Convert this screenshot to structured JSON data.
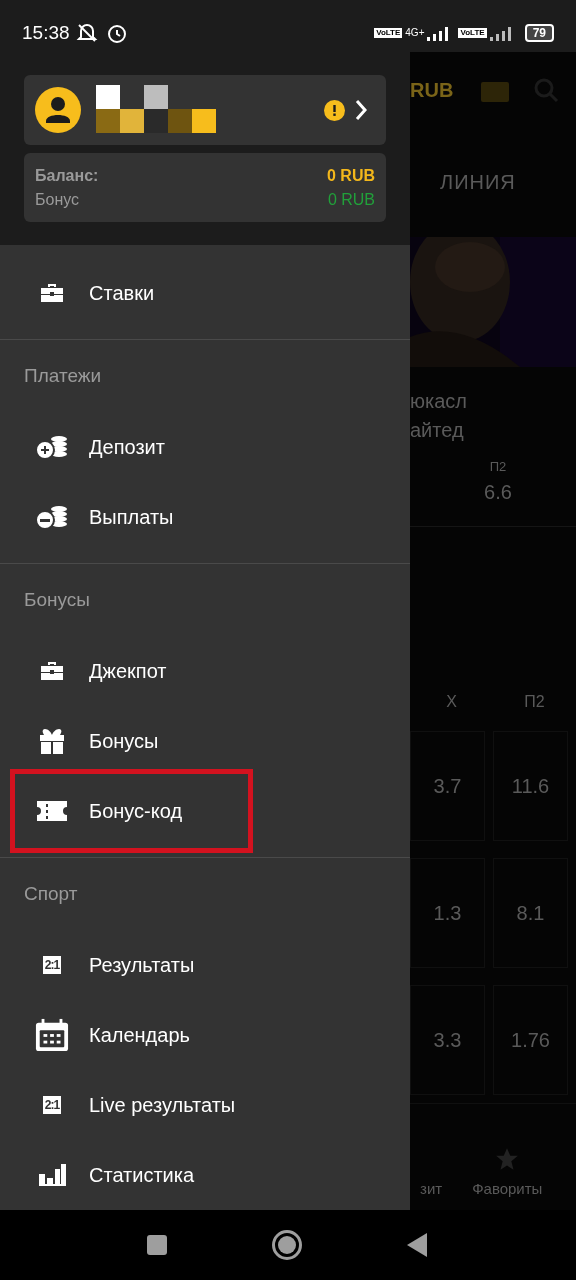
{
  "status_bar": {
    "time": "15:38",
    "network": "4G+",
    "sim_badges": [
      "VoLTE",
      "VoLTE"
    ],
    "battery": "79"
  },
  "account": {
    "warning": true
  },
  "balance": [
    {
      "kind": "main",
      "label": "Баланс:",
      "value": "0 RUB"
    },
    {
      "kind": "bonus",
      "label": "Бонус",
      "value": "0 RUB"
    }
  ],
  "top_items": [
    {
      "kind": "briefcase",
      "label": "Ставки",
      "highlighted": false
    }
  ],
  "sections": [
    {
      "title": "Платежи",
      "items": [
        {
          "kind": "coins-plus",
          "label": "Депозит",
          "highlighted": false
        },
        {
          "kind": "coins-minus",
          "label": "Выплаты",
          "highlighted": false
        }
      ]
    },
    {
      "title": "Бонусы",
      "items": [
        {
          "kind": "briefcase",
          "label": "Джекпот",
          "highlighted": false
        },
        {
          "kind": "gift",
          "label": "Бонусы",
          "highlighted": false
        },
        {
          "kind": "ticket",
          "label": "Бонус-код",
          "highlighted": true
        }
      ]
    },
    {
      "title": "Спорт",
      "items": [
        {
          "kind": "score",
          "icon_text": "2:1",
          "label": "Результаты",
          "highlighted": false
        },
        {
          "kind": "calendar",
          "label": "Календарь",
          "highlighted": false
        },
        {
          "kind": "score",
          "icon_text": "2:1",
          "label": "Live результаты",
          "highlighted": false
        },
        {
          "kind": "chart",
          "label": "Статистика",
          "highlighted": false
        }
      ]
    }
  ],
  "background": {
    "currency": "RUB",
    "tab": "ЛИНИЯ",
    "teams": [
      "юкасл",
      "айтед"
    ],
    "odds_header": "П2",
    "odds_value": "6.6",
    "table_header": [
      "X",
      "П2"
    ],
    "rows": [
      [
        "3.7",
        "11.6"
      ],
      [
        "1.3",
        "8.1"
      ],
      [
        "3.3",
        "1.76"
      ]
    ],
    "nav": [
      "зит",
      "Фавориты"
    ]
  }
}
